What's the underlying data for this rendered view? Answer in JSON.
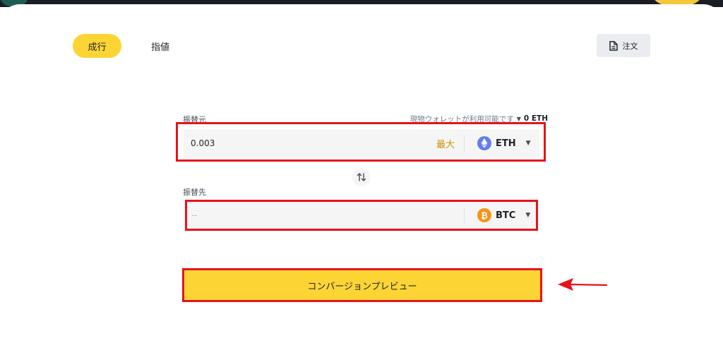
{
  "tabs": {
    "market_label": "成行",
    "limit_label": "指値"
  },
  "orders_button": {
    "label": "注文",
    "icon": "document-icon"
  },
  "from": {
    "label": "振替元",
    "wallet_text": "現物ウォレットが利用可能です",
    "balance": "0 ETH",
    "amount": "0.003",
    "max_label": "最大",
    "coin": "ETH",
    "coin_icon": "eth-icon",
    "coin_color": "#627eea"
  },
  "to": {
    "label": "振替先",
    "placeholder": "--",
    "coin": "BTC",
    "coin_icon": "btc-icon",
    "coin_color": "#f7931a"
  },
  "swap_icon": "swap-arrows-icon",
  "preview_button": {
    "label": "コンバージョンプレビュー"
  },
  "colors": {
    "accent": "#fcd535",
    "highlight": "#e8121a",
    "max_text": "#c99400"
  }
}
